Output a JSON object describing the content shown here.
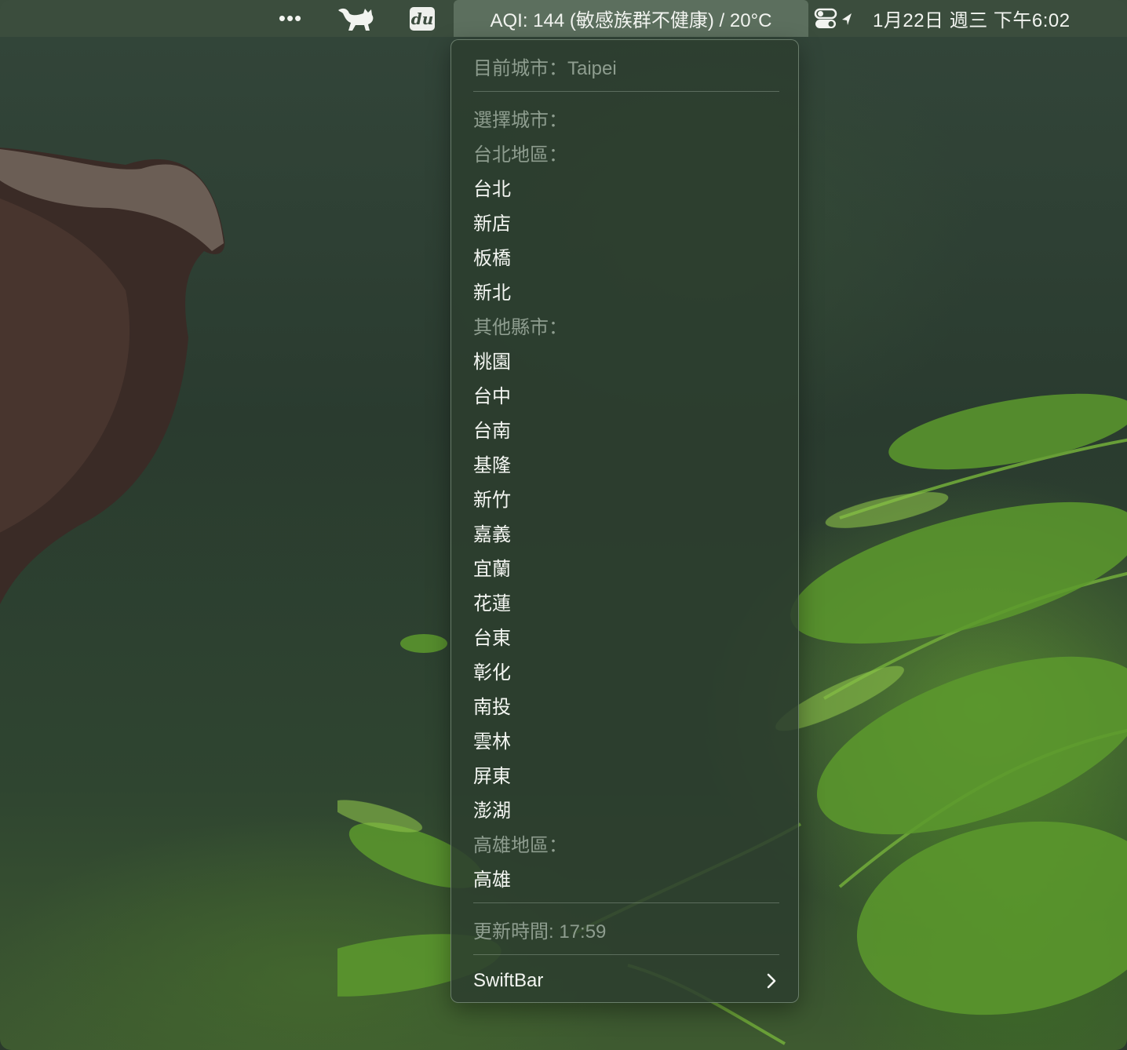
{
  "menubar": {
    "more_icon": "•••",
    "cat_icon": "cat-icon",
    "du_label": "du",
    "aqi_title": "AQI: 144 (敏感族群不健康) / 20°C",
    "control_icon": "control-center-icon",
    "datetime": "1月22日 週三  下午6:02"
  },
  "menu": {
    "current_city": "目前城市：Taipei",
    "select_city_header": "選擇城市：",
    "taipei_area_header": "台北地區：",
    "taipei_area_items": [
      "台北",
      "新店",
      "板橋",
      "新北"
    ],
    "other_cities_header": "其他縣市：",
    "other_cities_items": [
      "桃園",
      "台中",
      "台南",
      "基隆",
      "新竹",
      "嘉義",
      "宜蘭",
      "花蓮",
      "台東",
      "彰化",
      "南投",
      "雲林",
      "屏東",
      "澎湖"
    ],
    "kaohsiung_area_header": "高雄地區：",
    "kaohsiung_area_items": [
      "高雄"
    ],
    "update_time": "更新時間: 17:59",
    "swiftbar_label": "SwiftBar"
  },
  "colors": {
    "menubar_bg": "#3c4e3e",
    "menu_bg": "#2c3e2e",
    "header_text": "#8e9d8f",
    "item_text": "#f4f6f2"
  }
}
